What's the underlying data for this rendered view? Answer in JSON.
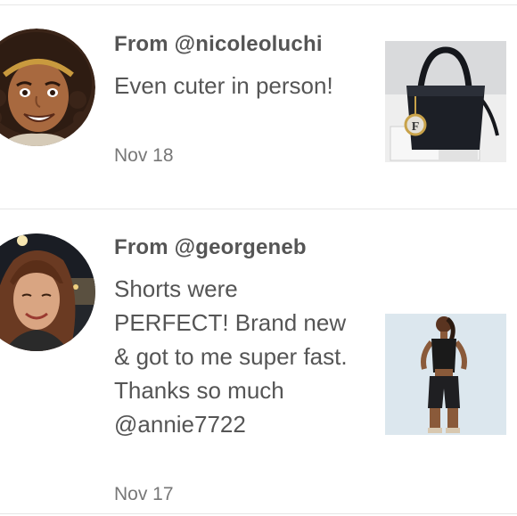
{
  "reviews": [
    {
      "from": "From @nicoleoluchi",
      "message": "Even cuter in person!",
      "date": "Nov 18",
      "avatar_icon": "bitmoji-avatar",
      "thumbnail_icon": "black-handbag-thumbnail"
    },
    {
      "from": "From @georgeneb",
      "message": "Shorts were PERFECT! Brand new & got to me super fast. Thanks so much @annie7722",
      "date": "Nov 17",
      "avatar_icon": "profile-photo-avatar",
      "thumbnail_icon": "biker-shorts-thumbnail"
    }
  ],
  "colors": {
    "text": "#555555",
    "date": "#777777",
    "divider": "#e6e6e6",
    "background": "#ffffff"
  }
}
